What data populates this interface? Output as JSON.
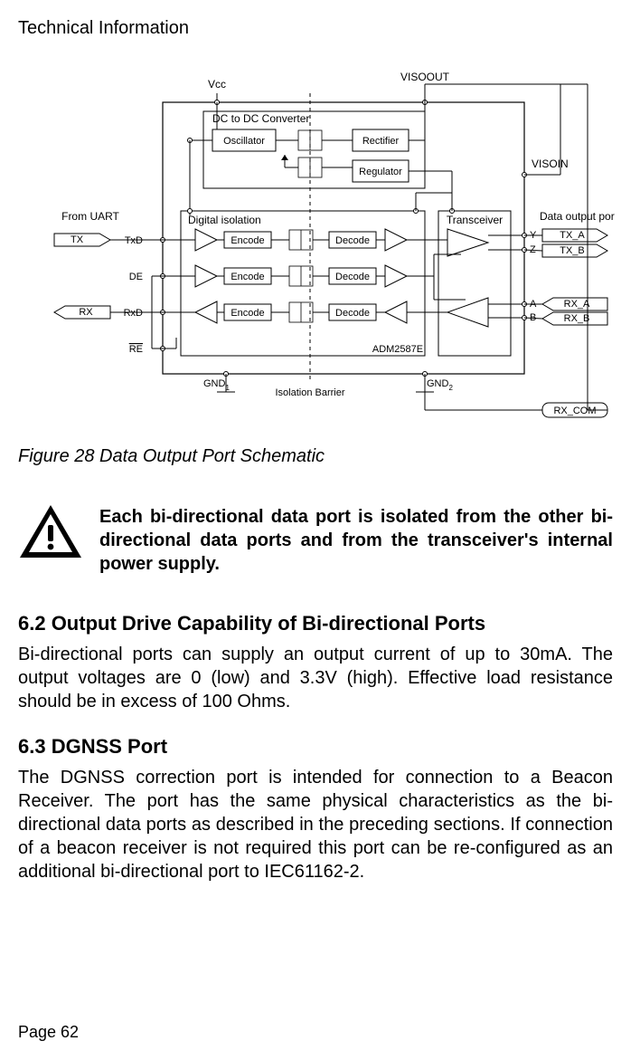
{
  "header": "Technical Information",
  "figure_caption": "Figure 28   Data Output Port Schematic",
  "warning_text": "Each bi-directional data port is isolated from the other bi-directional data ports and from the transceiver's internal power supply.",
  "section62_title": "6.2   Output Drive Capability of Bi-directional Ports",
  "section62_body": "Bi-directional ports can supply an output current of up to 30mA. The output voltages are 0 (low) and 3.3V (high). Effective load resistance should be in excess of 100 Ohms.",
  "section63_title": "6.3   DGNSS Port",
  "section63_body": "The DGNSS correction port is intended for connection to a Beacon Receiver. The port has the same physical characteristics as the bi-directional data ports as described in the preceding sections. If connection of a beacon receiver is not required this port can be re-configured as an additional bi-directional port to IEC61162-2.",
  "page_num": "Page  62",
  "diagram": {
    "top": {
      "vcc": "Vcc",
      "visoout": "VISOOUT",
      "visoin": "VISOIN"
    },
    "dcdc": {
      "title": "DC to DC Converter",
      "osc": "Oscillator",
      "rect": "Rectifier",
      "reg": "Regulator"
    },
    "left": {
      "from": "From UART",
      "tx": "TX",
      "rx": "RX",
      "txd": "TxD",
      "de": "DE",
      "rxd": "RxD",
      "re": "RE"
    },
    "iso": {
      "title": "Digital isolation",
      "e1": "Encode",
      "e2": "Encode",
      "e3": "Encode",
      "d1": "Decode",
      "d2": "Decode",
      "d3": "Decode"
    },
    "trans": "Transceiver",
    "right": {
      "dataout": "Data output port",
      "y": "Y",
      "z": "Z",
      "a": "A",
      "b": "B",
      "txa": "TX_A",
      "txb": "TX_B",
      "rxa": "RX_A",
      "rxb": "RX_B",
      "rxcom": "RX_COM"
    },
    "bottom": {
      "gnd1a": "GND",
      "gnd1b": "1",
      "gnd2a": "GND",
      "gnd2b": "2",
      "barrier": "Isolation Barrier",
      "chip": "ADM2587E"
    }
  }
}
